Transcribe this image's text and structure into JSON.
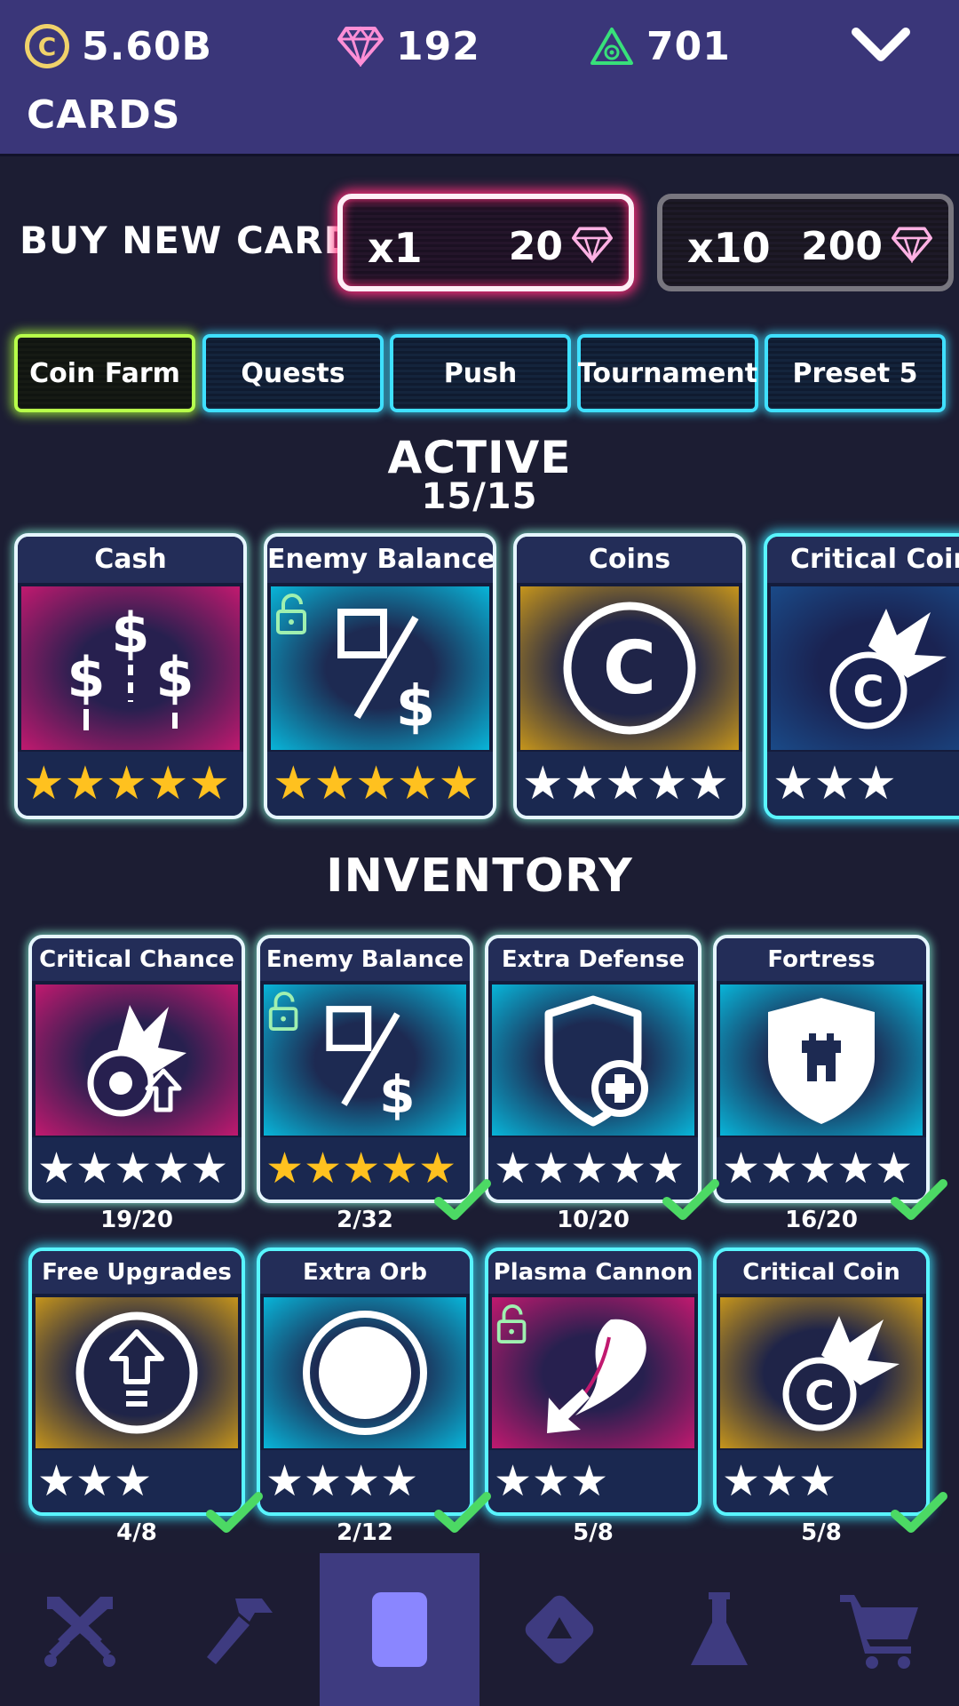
{
  "resources": {
    "coins": "5.60B",
    "gems": "192",
    "medals": "701"
  },
  "header": {
    "title": "CARDS"
  },
  "buy": {
    "label": "BUY NEW CARD",
    "options": [
      {
        "qty": "x1",
        "cost": "20"
      },
      {
        "qty": "x10",
        "cost": "200"
      }
    ]
  },
  "tabs": [
    "Coin Farm",
    "Quests",
    "Push",
    "Tournament",
    "Preset 5"
  ],
  "active": {
    "title": "ACTIVE",
    "count": "15/15",
    "cards": [
      {
        "name": "Cash",
        "stars": 5,
        "star_color": "gold"
      },
      {
        "name": "Enemy Balance",
        "stars": 5,
        "star_color": "gold"
      },
      {
        "name": "Coins",
        "stars": 5,
        "star_color": "white"
      },
      {
        "name": "Critical Coin",
        "stars": 3,
        "star_color": "white"
      }
    ]
  },
  "inventory": {
    "title": "INVENTORY",
    "cards": [
      {
        "name": "Critical Chance",
        "stars": 5,
        "star_color": "white",
        "count": "19/20",
        "equipped": false
      },
      {
        "name": "Enemy Balance",
        "stars": 5,
        "star_color": "gold",
        "count": "2/32",
        "equipped": true
      },
      {
        "name": "Extra Defense",
        "stars": 5,
        "star_color": "white",
        "count": "10/20",
        "equipped": true
      },
      {
        "name": "Fortress",
        "stars": 5,
        "star_color": "white",
        "count": "16/20",
        "equipped": true
      },
      {
        "name": "Free Upgrades",
        "stars": 3,
        "star_color": "white",
        "count": "4/8",
        "equipped": true
      },
      {
        "name": "Extra Orb",
        "stars": 4,
        "star_color": "white",
        "count": "2/12",
        "equipped": true
      },
      {
        "name": "Plasma Cannon",
        "stars": 3,
        "star_color": "white",
        "count": "5/8",
        "equipped": false
      },
      {
        "name": "Critical Coin",
        "stars": 3,
        "star_color": "white",
        "count": "5/8",
        "equipped": true
      }
    ]
  },
  "nav": [
    {
      "icon": "crossed-swords-icon",
      "active": false
    },
    {
      "icon": "hammer-icon",
      "active": false
    },
    {
      "icon": "card-icon",
      "active": true
    },
    {
      "icon": "triangle-diamond-icon",
      "active": false
    },
    {
      "icon": "flask-icon",
      "active": false
    },
    {
      "icon": "cart-icon",
      "active": false
    }
  ],
  "colors": {
    "header_bg": "#3a3679",
    "page_bg": "#1c1d33",
    "gold_star": "#ffc11f",
    "active_tab_border": "#b8ff4a",
    "tab_border": "#3fe0ff",
    "buy_x1_glow": "#ff2f7a"
  }
}
